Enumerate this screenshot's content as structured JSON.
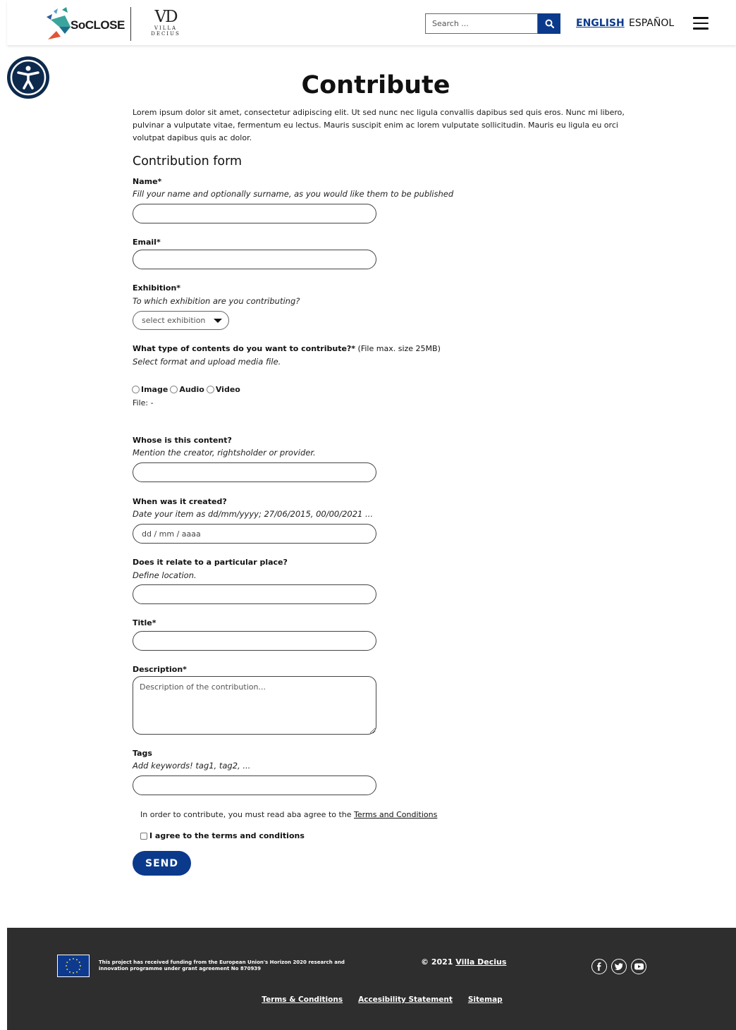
{
  "header": {
    "logo_soclose_text": "SoCLOSE",
    "logo_vd_mark": "VD",
    "logo_vd_sub1": "VILLA",
    "logo_vd_sub2": "DECIUS",
    "search_placeholder": "Search ...",
    "search_icon": "search-icon",
    "lang_english": "ENGLISH",
    "lang_spanish": "ESPAÑOL",
    "menu_icon": "hamburger-menu-icon",
    "accent_color": "#0b3a8c"
  },
  "accessibility_icon": "accessibility-icon",
  "main": {
    "title": "Contribute",
    "intro": "Lorem ipsum dolor sit amet, consectetur adipiscing elit. Ut sed nunc nec ligula convallis dapibus sed quis eros. Nunc mi libero, pulvinar a vulputate vitae, fermentum eu lectus. Mauris suscipit enim ac lorem vulputate sollicitudin. Mauris eu ligula eu orci volutpat dapibus quis ac dolor.",
    "form_heading": "Contribution form"
  },
  "form": {
    "name_label": "Name*",
    "name_hint": "Fill your name and optionally surname, as you would like them to be published",
    "email_label": "Email*",
    "exhibition_label": "Exhibition*",
    "exhibition_hint": "To which exhibition are you contributing?",
    "exhibition_select": "select exhibition",
    "content_type_label": "What type of contents do you want to contribute?*",
    "content_type_note": " (File max. size 25MB)",
    "content_type_hint": "Select format and upload media file.",
    "radio_image": "Image",
    "radio_audio": "Audio",
    "radio_video": "Video",
    "file_line": "File: -",
    "owner_label": "Whose is this content?",
    "owner_hint": "Mention the creator, rightsholder or provider.",
    "created_label": "When was it created?",
    "created_hint": "Date your item as dd/mm/yyyy; 27/06/2015, 00/00/2021 ...",
    "created_placeholder": "dd / mm / aaaa",
    "place_label": "Does it relate to a particular place?",
    "place_hint": "Define location.",
    "title_label": "Title*",
    "description_label": "Description*",
    "description_placeholder": "Description of the contribution...",
    "tags_label": "Tags",
    "tags_hint": "Add keywords! tag1, tag2, ...",
    "terms_note": "In order to contribute, you must read aba agree to the ",
    "terms_link": "Terms and Conditions",
    "agree_label": "I agree to the terms and conditions",
    "send_label": "SEND"
  },
  "footer": {
    "funding": "This project has received funding from the European Union's Horizon 2020 research and innovation programme under grant agreement No 870939",
    "copyright_prefix": "© 2021 ",
    "copyright_link": "Villa Decius",
    "social": [
      "facebook-icon",
      "twitter-icon",
      "youtube-icon"
    ],
    "links": [
      "Terms & Conditions",
      "Accesibility Statement",
      "Sitemap"
    ],
    "bg_color": "#2e2e2e"
  }
}
